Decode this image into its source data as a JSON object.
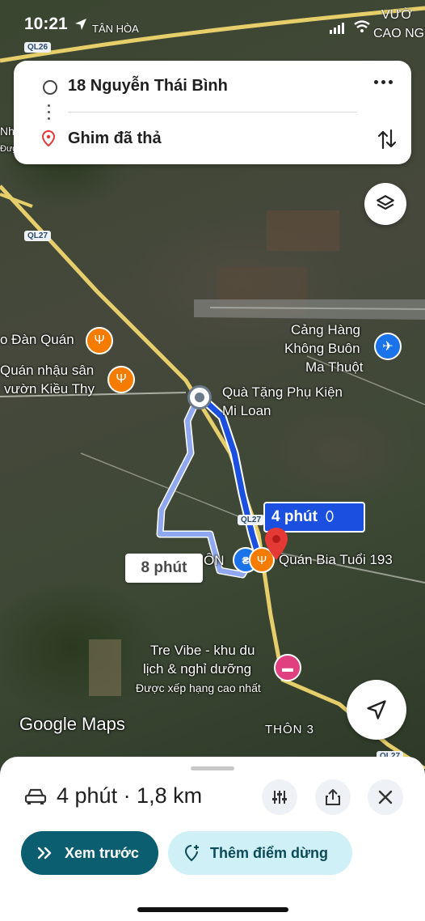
{
  "status_bar": {
    "time": "10:21",
    "place": "TÂN HÒA",
    "top_right_text_1": "VƯỜ",
    "top_right_text_2": "CAO NG"
  },
  "route_card": {
    "origin": "18 Nguyễn Thái Bình",
    "destination": "Ghim đã thả"
  },
  "map": {
    "road_tags": [
      "QL26",
      "QL27",
      "QL27",
      "QL27"
    ],
    "labels": {
      "dan_quan": "o Đàn Quán",
      "quan_nhau_1": "Quán nhậu sân",
      "quan_nhau_2": "vườn Kiều Thy",
      "nh": "Nh",
      "dug": "Đưg",
      "airport_1": "Cảng Hàng",
      "airport_2": "Không Buôn",
      "airport_3": "Ma Thuột",
      "qua_tang_1": "Quà Tặng Phụ Kiện",
      "qua_tang_2": "Mi Loan",
      "quan_bia": "Quán Bia Tuổi 193",
      "on": "ÔN",
      "tre_vibe_1": "Tre Vibe - khu du",
      "tre_vibe_2": "lịch & nghỉ dưỡng",
      "tre_vibe_3": "Được xếp hạng cao nhất",
      "thon3": "THÔN 3",
      "google_maps": "Google Maps"
    },
    "route_primary_time": "4 phút",
    "route_alt_time": "8 phút",
    "colors": {
      "route_primary": "#1a4fe0",
      "route_alt": "#8fa8f0",
      "pin": "#e53935",
      "food": "#f57c00",
      "hotel": "#e0407f"
    }
  },
  "bottom_sheet": {
    "summary": "4 phút · 1,8 km",
    "preview_label": "Xem trước",
    "add_stop_label": "Thêm điểm dừng",
    "colors": {
      "preview_bg": "#0b5e6f",
      "add_stop_bg": "#cff0f7"
    }
  }
}
